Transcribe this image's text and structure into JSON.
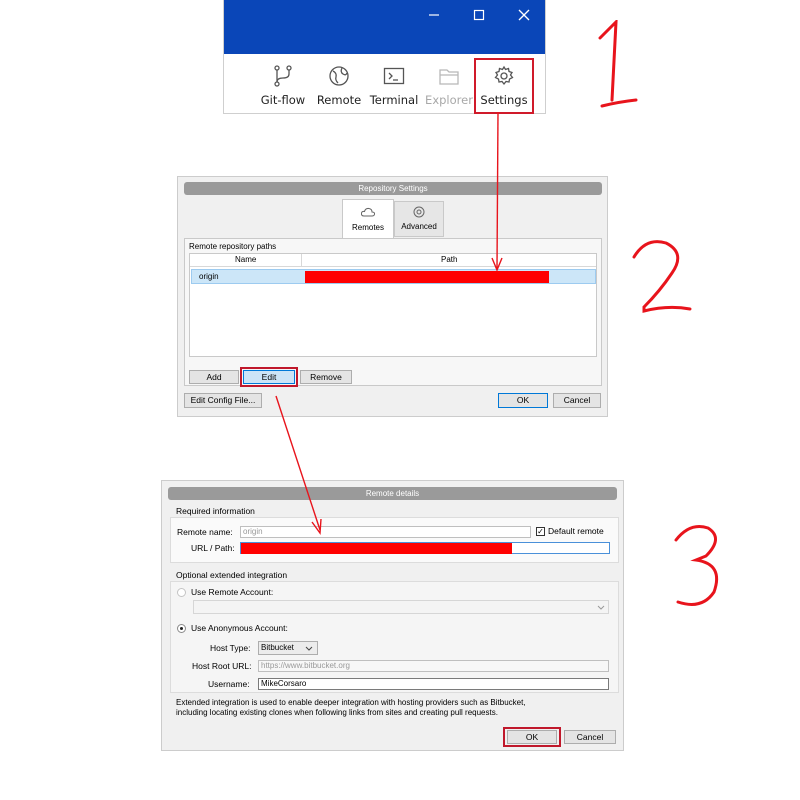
{
  "toolbar": {
    "tools": [
      {
        "label": "Git-flow",
        "icon": "git-flow-icon"
      },
      {
        "label": "Remote",
        "icon": "globe-icon"
      },
      {
        "label": "Terminal",
        "icon": "terminal-icon"
      },
      {
        "label": "Explorer",
        "icon": "folder-icon",
        "disabled": true
      },
      {
        "label": "Settings",
        "icon": "gear-icon",
        "highlighted": true
      }
    ],
    "title_bar_color": "#0a46b8"
  },
  "repo_settings": {
    "title": "Repository Settings",
    "tabs": [
      {
        "label": "Remotes",
        "icon": "cloud-icon",
        "selected": true
      },
      {
        "label": "Advanced",
        "icon": "gear-icon"
      }
    ],
    "section_label": "Remote repository paths",
    "columns": [
      "Name",
      "Path"
    ],
    "rows": [
      {
        "name": "origin",
        "path": ""
      }
    ],
    "buttons": {
      "add": "Add",
      "edit": "Edit",
      "remove": "Remove"
    },
    "edit_config": "Edit Config File...",
    "ok": "OK",
    "cancel": "Cancel"
  },
  "remote_details": {
    "title": "Remote details",
    "required_label": "Required information",
    "remote_name_label": "Remote name:",
    "remote_name_value": "origin",
    "default_remote_label": "Default remote",
    "default_remote_checked": true,
    "url_label": "URL / Path:",
    "optional_label": "Optional extended integration",
    "use_remote_account": "Use Remote Account:",
    "use_anonymous_account": "Use Anonymous Account:",
    "host_type_label": "Host Type:",
    "host_type_value": "Bitbucket",
    "host_root_url_label": "Host Root URL:",
    "host_root_url_value": "https://www.bitbucket.org",
    "username_label": "Username:",
    "username_value": "MikeCorsaro",
    "note_line1": "Extended integration is used to enable deeper integration with hosting providers such as Bitbucket,",
    "note_line2": "including locating existing clones when following links from sites and creating pull requests.",
    "ok": "OK",
    "cancel": "Cancel"
  },
  "annotations": {
    "steps": [
      "1",
      "2",
      "3"
    ],
    "color": "#e8141c"
  }
}
